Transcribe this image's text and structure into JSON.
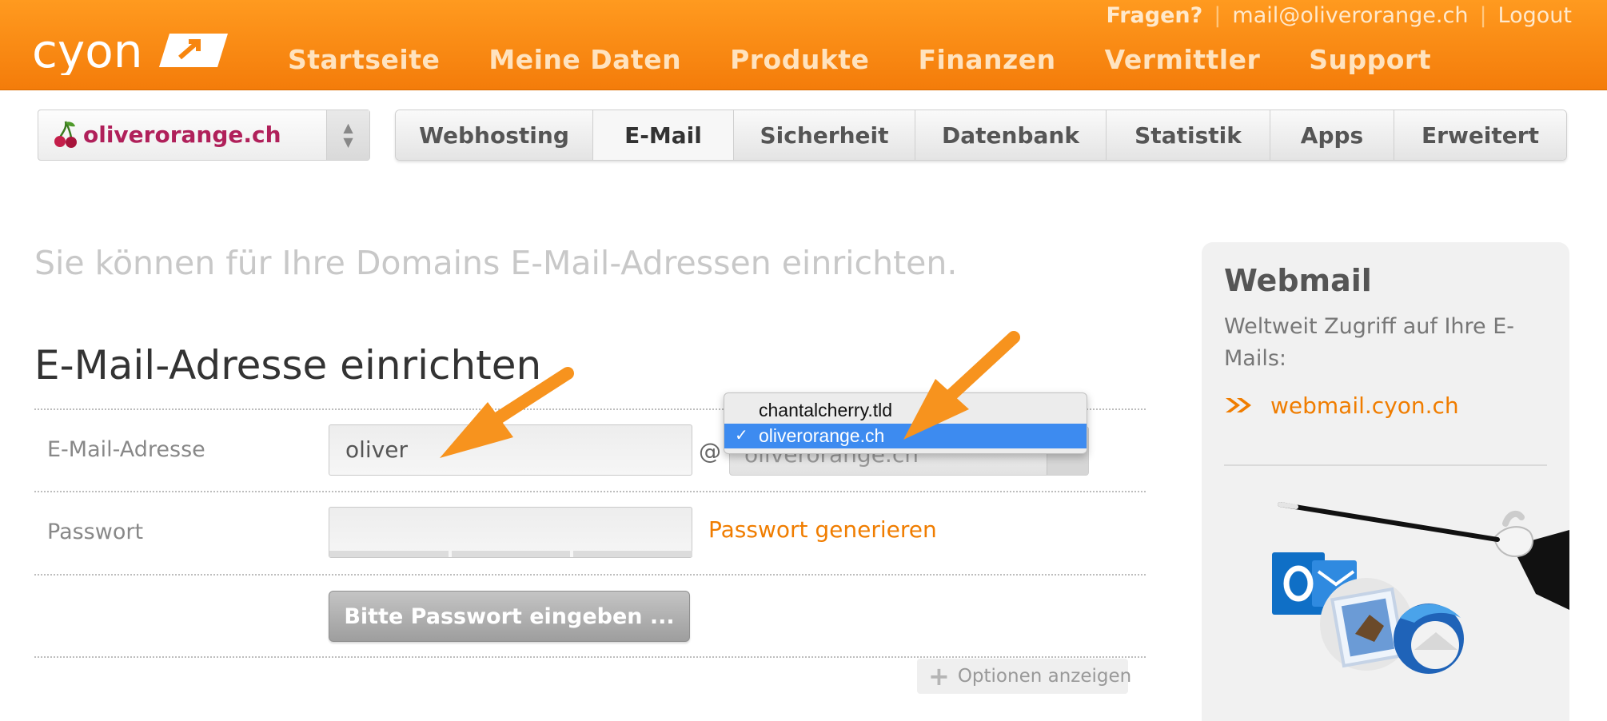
{
  "header": {
    "logo_text": "cyon",
    "top_links": {
      "help": "Fragen?",
      "email": "mail@oliverorange.ch",
      "logout": "Logout"
    },
    "nav": [
      "Startseite",
      "Meine Daten",
      "Produkte",
      "Finanzen",
      "Vermittler",
      "Support"
    ]
  },
  "domain_selector": {
    "value": "oliverorange.ch"
  },
  "tabs": [
    {
      "label": "Webhosting",
      "active": false
    },
    {
      "label": "E-Mail",
      "active": true
    },
    {
      "label": "Sicherheit",
      "active": false
    },
    {
      "label": "Datenbank",
      "active": false
    },
    {
      "label": "Statistik",
      "active": false
    },
    {
      "label": "Apps",
      "active": false
    },
    {
      "label": "Erweitert",
      "active": false
    }
  ],
  "main": {
    "intro": "Sie können für Ihre Domains E-Mail-Adressen einrichten.",
    "title": "E-Mail-Adresse einrichten",
    "email_label": "E-Mail-Adresse",
    "email_value": "oliver",
    "at_sign": "@",
    "domain_select_value": "oliverorange.ch",
    "domain_options": [
      {
        "label": "chantalcherry.tld",
        "selected": false
      },
      {
        "label": "oliverorange.ch",
        "selected": true
      }
    ],
    "password_label": "Passwort",
    "password_value": "",
    "generate_link": "Passwort generieren",
    "submit_label": "Bitte Passwort eingeben ...",
    "options_label": "Optionen anzeigen"
  },
  "sidebar": {
    "title": "Webmail",
    "text": "Weltweit Zugriff auf Ihre E-Mails:",
    "link": "webmail.cyon.ch"
  },
  "colors": {
    "header_orange": "#f7860f",
    "accent_orange": "#f07d00",
    "domain_magenta": "#b0205a",
    "dropdown_selected": "#3d8bf0"
  }
}
